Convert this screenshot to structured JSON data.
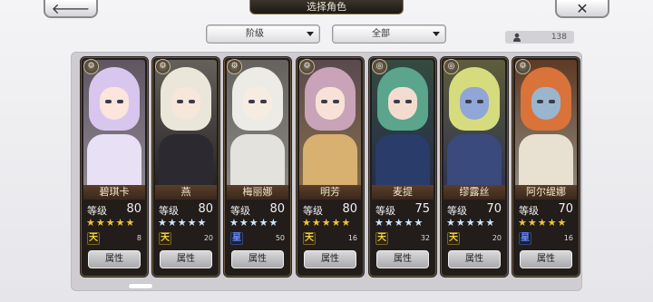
{
  "header": {
    "title": "选择角色",
    "back_glyph": "🡐",
    "close_glyph": "✕"
  },
  "filters": {
    "rank_label": "阶级",
    "category_label": "全部"
  },
  "roster_count": "138",
  "colors": {
    "card_bg": "#221d1a",
    "name_plate": "#5a3e2a",
    "star_gold": "#f0c23a",
    "star_blue": "#cfe6ff",
    "panel_bg": "#cfcdd2"
  },
  "level_label": "等级",
  "attr_label": "属性",
  "characters": [
    {
      "name": "碧琪卡",
      "level": "80",
      "stars": "★★★★★",
      "star_style": "gold",
      "rank": "天",
      "rank_style": "gold",
      "count": "8",
      "type_icon": "⚙",
      "hair": "#d9c6ee",
      "skin": "#fbe5dd",
      "body": "#e8e0f4"
    },
    {
      "name": "燕",
      "level": "80",
      "stars": "★★★★★",
      "star_style": "blue",
      "rank": "天",
      "rank_style": "gold",
      "count": "20",
      "type_icon": "⚙",
      "hair": "#eae7da",
      "skin": "#f7e6da",
      "body": "#2c2a30"
    },
    {
      "name": "梅丽娜",
      "level": "80",
      "stars": "★★★★★",
      "star_style": "blue",
      "rank": "星",
      "rank_style": "blue",
      "count": "50",
      "type_icon": "⚙",
      "hair": "#ecebe6",
      "skin": "#f7ece2",
      "body": "#e4e2dc"
    },
    {
      "name": "明芳",
      "level": "80",
      "stars": "★★★★★",
      "star_style": "gold",
      "rank": "天",
      "rank_style": "gold",
      "count": "16",
      "type_icon": "⚙",
      "hair": "#c9a3b8",
      "skin": "#f8e2d8",
      "body": "#d8b070"
    },
    {
      "name": "麦提",
      "level": "75",
      "stars": "★★★★★",
      "star_style": "blue",
      "rank": "天",
      "rank_style": "gold",
      "count": "32",
      "type_icon": "◎",
      "hair": "#5aa58c",
      "skin": "#f3dccf",
      "body": "#2a3c6a"
    },
    {
      "name": "缪露丝",
      "level": "70",
      "stars": "★★★★★",
      "star_style": "blue",
      "rank": "天",
      "rank_style": "gold",
      "count": "20",
      "type_icon": "◎",
      "hair": "#d6dc7e",
      "skin": "#8fa6d6",
      "body": "#3a4a7c"
    },
    {
      "name": "阿尔缇娜",
      "level": "70",
      "stars": "★★★★★",
      "star_style": "gold",
      "rank": "星",
      "rank_style": "blue",
      "count": "16",
      "type_icon": "⚙",
      "hair": "#d9733a",
      "skin": "#9ab6ce",
      "body": "#e8e0d0"
    }
  ]
}
